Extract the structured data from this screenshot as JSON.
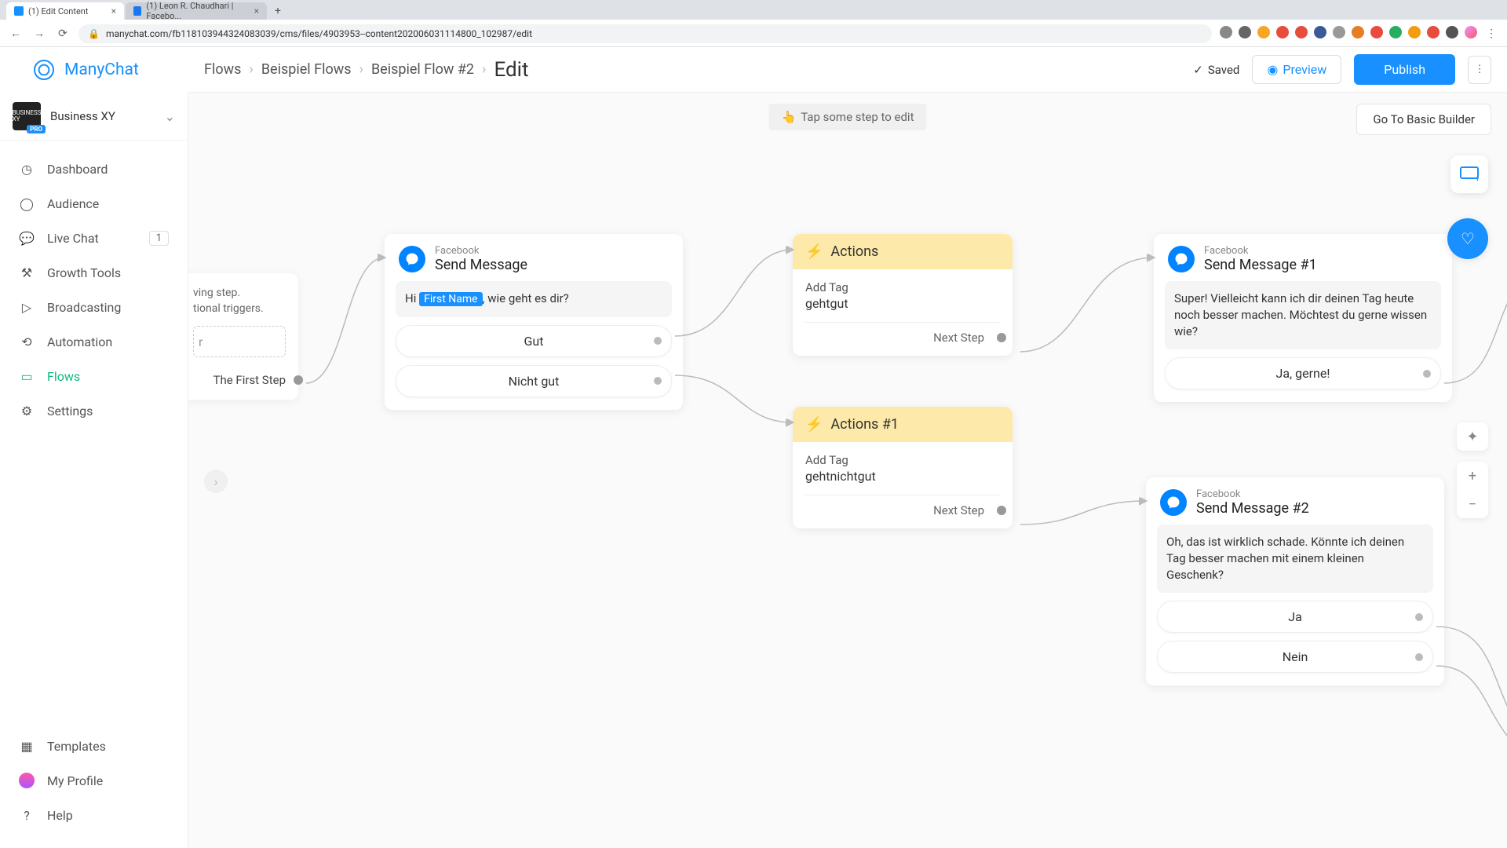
{
  "browser": {
    "tabs": [
      {
        "title": "(1) Edit Content",
        "active": true
      },
      {
        "title": "(1) Leon R. Chaudhari | Facebo...",
        "active": false
      }
    ],
    "url": "manychat.com/fb118103944324083039/cms/files/4903953--content202006031114800_102987/edit"
  },
  "app": {
    "logo": "ManyChat",
    "workspace": {
      "name": "Business XY",
      "badge": "PRO"
    },
    "breadcrumbs": [
      "Flows",
      "Beispiel Flows",
      "Beispiel Flow #2"
    ],
    "current_page": "Edit",
    "saved_label": "Saved",
    "preview_label": "Preview",
    "publish_label": "Publish",
    "basic_builder_label": "Go To Basic Builder",
    "hint": "Tap some step to edit"
  },
  "sidebar": {
    "items": [
      {
        "label": "Dashboard",
        "icon": "gauge"
      },
      {
        "label": "Audience",
        "icon": "users"
      },
      {
        "label": "Live Chat",
        "icon": "chat",
        "badge": "1"
      },
      {
        "label": "Growth Tools",
        "icon": "tools"
      },
      {
        "label": "Broadcasting",
        "icon": "send"
      },
      {
        "label": "Automation",
        "icon": "auto"
      },
      {
        "label": "Flows",
        "icon": "folder",
        "active": true
      },
      {
        "label": "Settings",
        "icon": "gear"
      }
    ],
    "bottom": [
      {
        "label": "Templates",
        "icon": "template"
      },
      {
        "label": "My Profile",
        "icon": "profile"
      },
      {
        "label": "Help",
        "icon": "help"
      }
    ]
  },
  "starter": {
    "text1": "ving step.",
    "text2": "tional triggers.",
    "text3": "r",
    "first_step": "The First Step"
  },
  "nodes": {
    "send1": {
      "provider": "Facebook",
      "title": "Send Message",
      "prefix": "Hi ",
      "variable": "First Name",
      "suffix": ", wie geht es dir?",
      "btn1": "Gut",
      "btn2": "Nicht gut"
    },
    "actions1": {
      "title": "Actions",
      "label": "Add Tag",
      "value": "gehtgut",
      "next": "Next Step"
    },
    "actions2": {
      "title": "Actions #1",
      "label": "Add Tag",
      "value": "gehtnichtgut",
      "next": "Next Step"
    },
    "send2": {
      "provider": "Facebook",
      "title": "Send Message #1",
      "message": "Super! Vielleicht kann ich dir deinen Tag heute noch besser machen. Möchtest du gerne wissen wie?",
      "btn1": "Ja, gerne!"
    },
    "send3": {
      "provider": "Facebook",
      "title": "Send Message #2",
      "message": "Oh, das ist wirklich schade. Könnte ich deinen Tag besser machen mit einem kleinen Geschenk?",
      "btn1": "Ja",
      "btn2": "Nein"
    }
  }
}
